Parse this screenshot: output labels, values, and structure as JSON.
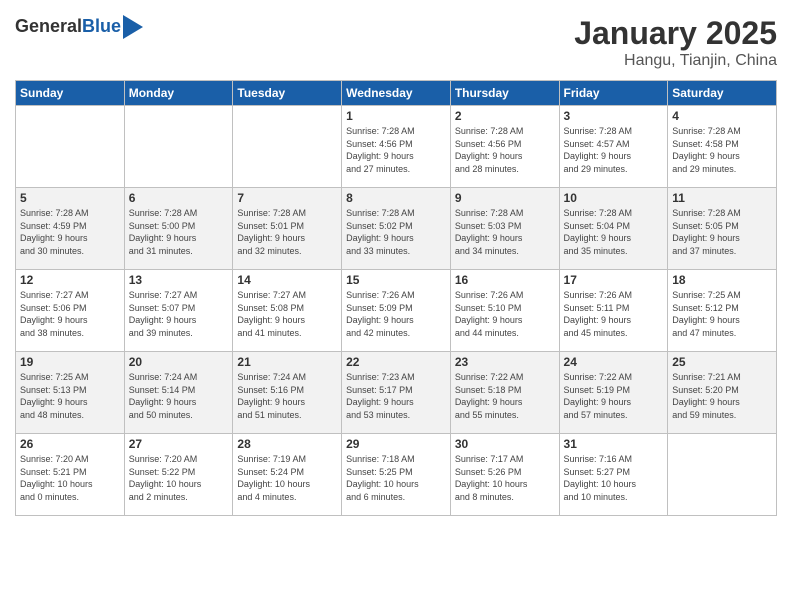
{
  "header": {
    "logo_general": "General",
    "logo_blue": "Blue",
    "title": "January 2025",
    "subtitle": "Hangu, Tianjin, China"
  },
  "days_of_week": [
    "Sunday",
    "Monday",
    "Tuesday",
    "Wednesday",
    "Thursday",
    "Friday",
    "Saturday"
  ],
  "weeks": [
    [
      {
        "day": "",
        "content": ""
      },
      {
        "day": "",
        "content": ""
      },
      {
        "day": "",
        "content": ""
      },
      {
        "day": "1",
        "content": "Sunrise: 7:28 AM\nSunset: 4:56 PM\nDaylight: 9 hours\nand 27 minutes."
      },
      {
        "day": "2",
        "content": "Sunrise: 7:28 AM\nSunset: 4:56 PM\nDaylight: 9 hours\nand 28 minutes."
      },
      {
        "day": "3",
        "content": "Sunrise: 7:28 AM\nSunset: 4:57 AM\nDaylight: 9 hours\nand 29 minutes."
      },
      {
        "day": "4",
        "content": "Sunrise: 7:28 AM\nSunset: 4:58 PM\nDaylight: 9 hours\nand 29 minutes."
      }
    ],
    [
      {
        "day": "5",
        "content": "Sunrise: 7:28 AM\nSunset: 4:59 PM\nDaylight: 9 hours\nand 30 minutes."
      },
      {
        "day": "6",
        "content": "Sunrise: 7:28 AM\nSunset: 5:00 PM\nDaylight: 9 hours\nand 31 minutes."
      },
      {
        "day": "7",
        "content": "Sunrise: 7:28 AM\nSunset: 5:01 PM\nDaylight: 9 hours\nand 32 minutes."
      },
      {
        "day": "8",
        "content": "Sunrise: 7:28 AM\nSunset: 5:02 PM\nDaylight: 9 hours\nand 33 minutes."
      },
      {
        "day": "9",
        "content": "Sunrise: 7:28 AM\nSunset: 5:03 PM\nDaylight: 9 hours\nand 34 minutes."
      },
      {
        "day": "10",
        "content": "Sunrise: 7:28 AM\nSunset: 5:04 PM\nDaylight: 9 hours\nand 35 minutes."
      },
      {
        "day": "11",
        "content": "Sunrise: 7:28 AM\nSunset: 5:05 PM\nDaylight: 9 hours\nand 37 minutes."
      }
    ],
    [
      {
        "day": "12",
        "content": "Sunrise: 7:27 AM\nSunset: 5:06 PM\nDaylight: 9 hours\nand 38 minutes."
      },
      {
        "day": "13",
        "content": "Sunrise: 7:27 AM\nSunset: 5:07 PM\nDaylight: 9 hours\nand 39 minutes."
      },
      {
        "day": "14",
        "content": "Sunrise: 7:27 AM\nSunset: 5:08 PM\nDaylight: 9 hours\nand 41 minutes."
      },
      {
        "day": "15",
        "content": "Sunrise: 7:26 AM\nSunset: 5:09 PM\nDaylight: 9 hours\nand 42 minutes."
      },
      {
        "day": "16",
        "content": "Sunrise: 7:26 AM\nSunset: 5:10 PM\nDaylight: 9 hours\nand 44 minutes."
      },
      {
        "day": "17",
        "content": "Sunrise: 7:26 AM\nSunset: 5:11 PM\nDaylight: 9 hours\nand 45 minutes."
      },
      {
        "day": "18",
        "content": "Sunrise: 7:25 AM\nSunset: 5:12 PM\nDaylight: 9 hours\nand 47 minutes."
      }
    ],
    [
      {
        "day": "19",
        "content": "Sunrise: 7:25 AM\nSunset: 5:13 PM\nDaylight: 9 hours\nand 48 minutes."
      },
      {
        "day": "20",
        "content": "Sunrise: 7:24 AM\nSunset: 5:14 PM\nDaylight: 9 hours\nand 50 minutes."
      },
      {
        "day": "21",
        "content": "Sunrise: 7:24 AM\nSunset: 5:16 PM\nDaylight: 9 hours\nand 51 minutes."
      },
      {
        "day": "22",
        "content": "Sunrise: 7:23 AM\nSunset: 5:17 PM\nDaylight: 9 hours\nand 53 minutes."
      },
      {
        "day": "23",
        "content": "Sunrise: 7:22 AM\nSunset: 5:18 PM\nDaylight: 9 hours\nand 55 minutes."
      },
      {
        "day": "24",
        "content": "Sunrise: 7:22 AM\nSunset: 5:19 PM\nDaylight: 9 hours\nand 57 minutes."
      },
      {
        "day": "25",
        "content": "Sunrise: 7:21 AM\nSunset: 5:20 PM\nDaylight: 9 hours\nand 59 minutes."
      }
    ],
    [
      {
        "day": "26",
        "content": "Sunrise: 7:20 AM\nSunset: 5:21 PM\nDaylight: 10 hours\nand 0 minutes."
      },
      {
        "day": "27",
        "content": "Sunrise: 7:20 AM\nSunset: 5:22 PM\nDaylight: 10 hours\nand 2 minutes."
      },
      {
        "day": "28",
        "content": "Sunrise: 7:19 AM\nSunset: 5:24 PM\nDaylight: 10 hours\nand 4 minutes."
      },
      {
        "day": "29",
        "content": "Sunrise: 7:18 AM\nSunset: 5:25 PM\nDaylight: 10 hours\nand 6 minutes."
      },
      {
        "day": "30",
        "content": "Sunrise: 7:17 AM\nSunset: 5:26 PM\nDaylight: 10 hours\nand 8 minutes."
      },
      {
        "day": "31",
        "content": "Sunrise: 7:16 AM\nSunset: 5:27 PM\nDaylight: 10 hours\nand 10 minutes."
      },
      {
        "day": "",
        "content": ""
      }
    ]
  ]
}
